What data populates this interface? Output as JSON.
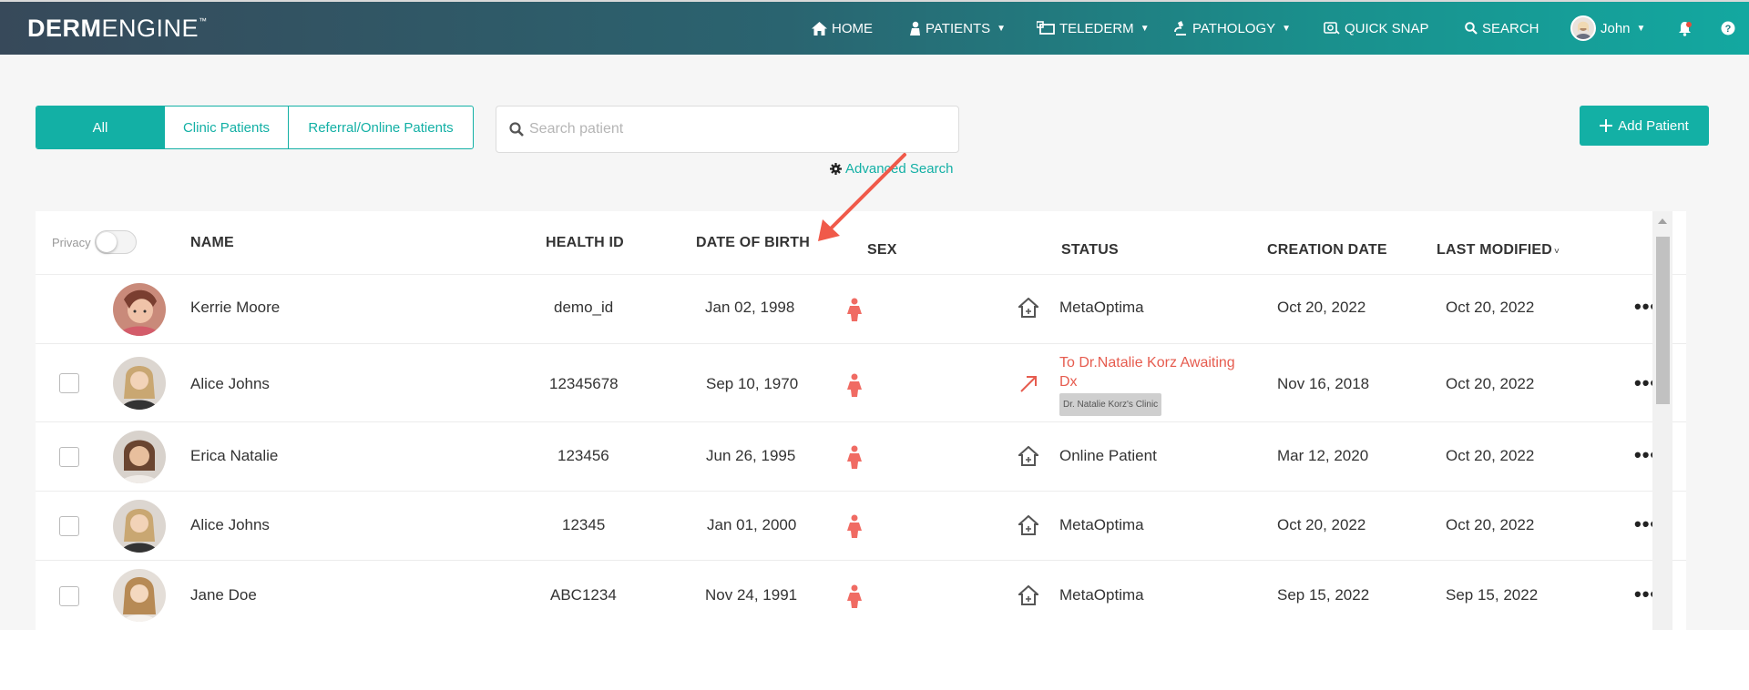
{
  "brand": {
    "bold": "DERM",
    "light": "ENGINE",
    "tm": "™"
  },
  "nav": {
    "home": "HOME",
    "patients": "PATIENTS",
    "telederm": "TELEDERM",
    "pathology": "PATHOLOGY",
    "quick_snap": "QUICK SNAP",
    "search": "SEARCH",
    "user": "John"
  },
  "filters": [
    "All",
    "Clinic Patients",
    "Referral/Online Patients"
  ],
  "search": {
    "placeholder": "Search patient",
    "advanced_label": "Advanced Search"
  },
  "add_patient_label": "Add Patient",
  "table": {
    "privacy_label": "Privacy",
    "headers": {
      "name": "NAME",
      "health_id": "HEALTH ID",
      "dob": "DATE OF BIRTH",
      "sex": "SEX",
      "status": "STATUS",
      "creation_date": "CREATION DATE",
      "last_modified": "LAST MODIFIED"
    },
    "rows": [
      {
        "name": "Kerrie Moore",
        "health_id": "demo_id",
        "dob": "Jan 02, 1998",
        "status": "MetaOptima",
        "status_icon": "house-icon",
        "creation": "Oct 20, 2022",
        "modified": "Oct 20, 2022"
      },
      {
        "name": "Alice Johns",
        "health_id": "12345678",
        "dob": "Sep 10, 1970",
        "status_line1": "To Dr.Natalie Korz Awaiting",
        "status_line2": "Dx",
        "clinic_tag": "Dr. Natalie Korz's Clinic",
        "status_icon": "referral-arrow-icon",
        "creation": "Nov 16, 2018",
        "modified": "Oct 20, 2022"
      },
      {
        "name": "Erica Natalie",
        "health_id": "123456",
        "dob": "Jun 26, 1995",
        "status": "Online Patient",
        "status_icon": "house-icon",
        "creation": "Mar 12, 2020",
        "modified": "Oct 20, 2022"
      },
      {
        "name": "Alice Johns",
        "health_id": "12345",
        "dob": "Jan 01, 2000",
        "status": "MetaOptima",
        "status_icon": "house-icon",
        "creation": "Oct 20, 2022",
        "modified": "Oct 20, 2022"
      },
      {
        "name": "Jane Doe",
        "health_id": "ABC1234",
        "dob": "Nov 24, 1991",
        "status": "MetaOptima",
        "status_icon": "house-icon",
        "creation": "Sep 15, 2022",
        "modified": "Sep 15, 2022"
      }
    ],
    "more_label": "•••"
  },
  "colors": {
    "accent": "#13b0a5",
    "female": "#f06b63",
    "status_red": "#e65c4f",
    "annotation_arrow": "#f05a4a"
  }
}
